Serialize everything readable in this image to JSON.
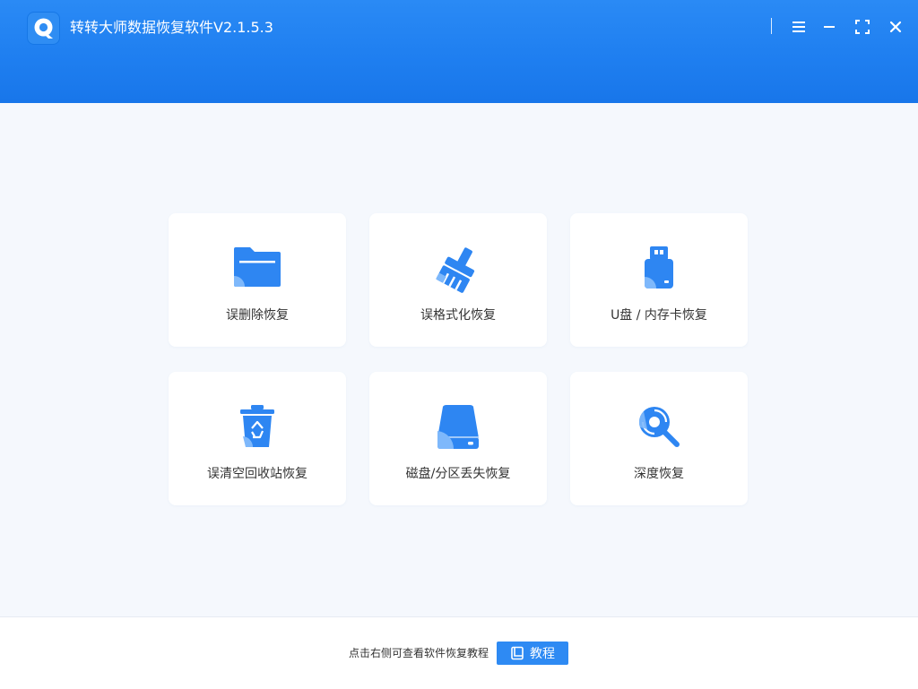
{
  "app": {
    "title": "转转大师数据恢复软件V2.1.5.3",
    "brand_color": "#1f7ff0",
    "logo_icon": "q-logo-icon"
  },
  "window_controls": [
    {
      "name": "menu",
      "icon": "menu-icon"
    },
    {
      "name": "minimize",
      "icon": "minimize-icon"
    },
    {
      "name": "maximize",
      "icon": "maximize-icon"
    },
    {
      "name": "close",
      "icon": "close-icon"
    }
  ],
  "modes": [
    {
      "label": "误删除恢复",
      "icon": "folder-icon"
    },
    {
      "label": "误格式化恢复",
      "icon": "broom-icon"
    },
    {
      "label": "U盘 / 内存卡恢复",
      "icon": "usb-drive-icon"
    },
    {
      "label": "误清空回收站恢复",
      "icon": "recycle-bin-icon"
    },
    {
      "label": "磁盘/分区丢失恢复",
      "icon": "hard-disk-icon"
    },
    {
      "label": "深度恢复",
      "icon": "deep-scan-icon"
    }
  ],
  "footer": {
    "hint": "点击右侧可查看软件恢复教程",
    "tutorial_label": "教程",
    "tutorial_icon": "book-icon"
  }
}
